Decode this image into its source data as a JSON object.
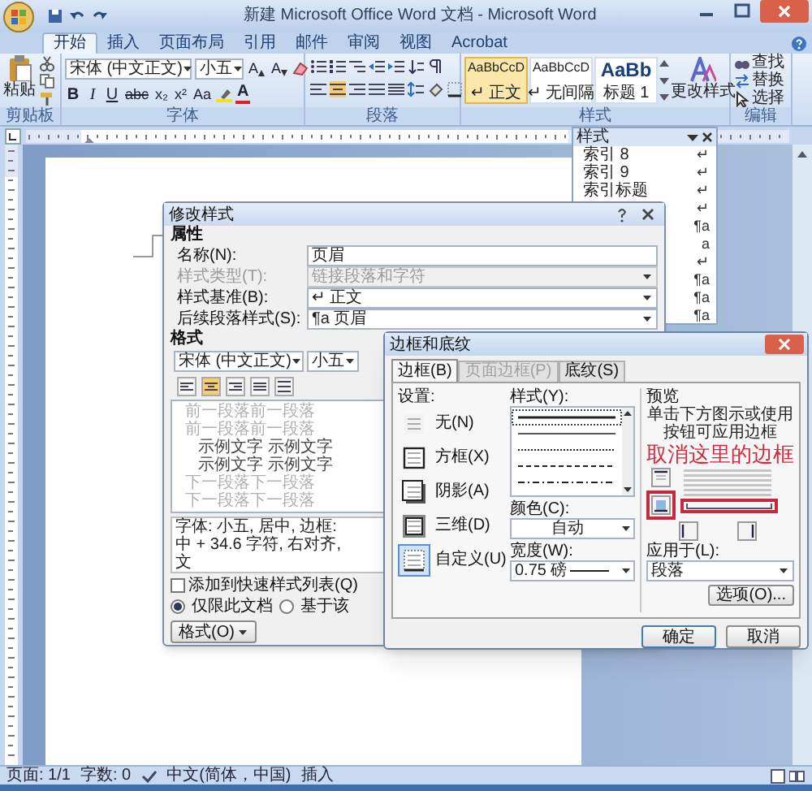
{
  "window": {
    "title": "新建 Microsoft Office Word 文档 - Microsoft Word"
  },
  "tabs": [
    {
      "label": "开始",
      "selected": true
    },
    {
      "label": "插入",
      "selected": false
    },
    {
      "label": "页面布局",
      "selected": false
    },
    {
      "label": "引用",
      "selected": false
    },
    {
      "label": "邮件",
      "selected": false
    },
    {
      "label": "审阅",
      "selected": false
    },
    {
      "label": "视图",
      "selected": false
    },
    {
      "label": "Acrobat",
      "selected": false
    }
  ],
  "ribbon": {
    "clipboard": {
      "paste": "粘贴",
      "label": "剪贴板"
    },
    "font": {
      "label": "字体",
      "font_name": "宋体 (中文正文)",
      "font_size": "小五",
      "size_buttons": [
        "A",
        "A"
      ],
      "format_buttons": [
        "B",
        "I",
        "U"
      ],
      "script_buttons": [
        "abc",
        "x₂",
        "x²",
        "Aa"
      ],
      "color_button": "A"
    },
    "paragraph": {
      "label": "段落"
    },
    "styles": {
      "label": "样式",
      "change": "更改样式",
      "gallery": [
        {
          "sample": "AaBbCcD",
          "name": "↵ 正文",
          "kind": "body",
          "selected": true
        },
        {
          "sample": "AaBbCcD",
          "name": "↵ 无间隔",
          "kind": "body",
          "selected": false
        },
        {
          "sample": "AaBb",
          "name": "标题 1",
          "kind": "heading",
          "selected": false
        }
      ]
    },
    "editing": {
      "label": "编辑",
      "commands": [
        {
          "label": "查找",
          "kind": "find"
        },
        {
          "label": "替换",
          "kind": "replace"
        },
        {
          "label": "选择",
          "kind": "select"
        }
      ]
    }
  },
  "styles_pane": {
    "title": "样式",
    "items": [
      {
        "name": "索引 8",
        "mark": "↵"
      },
      {
        "name": "索引 9",
        "mark": "↵"
      },
      {
        "name": "索引标题",
        "mark": "↵"
      },
      {
        "mark": "↵"
      },
      {
        "mark": "¶a"
      },
      {
        "mark": "a"
      },
      {
        "mark": "↵"
      },
      {
        "mark": "¶a"
      },
      {
        "mark": "¶a"
      },
      {
        "mark": "¶a"
      }
    ]
  },
  "modify_style_dialog": {
    "title": "修改样式",
    "properties_label": "属性",
    "fields": [
      {
        "label": "名称(N):",
        "value": "页眉",
        "kind": "text",
        "disabled": false
      },
      {
        "label": "样式类型(T):",
        "value": "链接段落和字符",
        "kind": "select",
        "disabled": true
      },
      {
        "label": "样式基准(B):",
        "value": "↵ 正文",
        "kind": "select",
        "disabled": false
      },
      {
        "label": "后续段落样式(S):",
        "value": "¶a 页眉",
        "kind": "select",
        "disabled": false
      }
    ],
    "format_label": "格式",
    "font_name": "宋体 (中文正文)",
    "font_size": "小五",
    "preview_lines": [
      {
        "text": "前一段落前一段落",
        "kind": "context"
      },
      {
        "text": "前一段落前一段落",
        "kind": "context"
      },
      {
        "text": "示例文字 示例文字",
        "kind": "sample"
      },
      {
        "text": "示例文字 示例文字",
        "kind": "sample"
      },
      {
        "text": "下一段落下一段落",
        "kind": "context"
      },
      {
        "text": "下一段落下一段落",
        "kind": "context"
      }
    ],
    "description_lines": [
      "字体: 小五, 居中, 边框:",
      "中 + 34.6 字符, 右对齐,",
      "文"
    ],
    "add_to_quick": {
      "label": "添加到快速样式列表(Q)",
      "checked": false
    },
    "scope": [
      {
        "label": "仅限此文档",
        "selected": true
      },
      {
        "label": "基于该",
        "selected": false
      }
    ],
    "format_button": "格式(O)"
  },
  "borders_dialog": {
    "title": "边框和底纹",
    "tabs": [
      {
        "label": "边框(B)",
        "selected": true,
        "disabled": false
      },
      {
        "label": "页面边框(P)",
        "selected": false,
        "disabled": true
      },
      {
        "label": "底纹(S)",
        "selected": false,
        "disabled": false
      }
    ],
    "setting_label": "设置:",
    "settings": [
      {
        "label": "无(N)",
        "kind": "none",
        "selected": false
      },
      {
        "label": "方框(X)",
        "kind": "box",
        "selected": false
      },
      {
        "label": "阴影(A)",
        "kind": "shadow",
        "selected": false
      },
      {
        "label": "三维(D)",
        "kind": "three_d",
        "selected": false
      },
      {
        "label": "自定义(U)",
        "kind": "custom",
        "selected": true
      }
    ],
    "style_label": "样式(Y):",
    "line_styles": [
      {
        "kind": "solid",
        "selected": true
      },
      {
        "kind": "thin",
        "selected": false
      },
      {
        "kind": "dotted",
        "selected": false
      },
      {
        "kind": "dashed",
        "selected": false
      },
      {
        "kind": "dash_dot",
        "selected": false
      }
    ],
    "color_label": "颜色(C):",
    "color_value": "自动",
    "width_label": "宽度(W):",
    "width_value": "0.75 磅",
    "preview_label": "预览",
    "preview_hint": "单击下方图示或使用按钮可应用边框",
    "annotation": "取消这里的边框",
    "apply_label": "应用于(L):",
    "apply_value": "段落",
    "options_button": "选项(O)...",
    "ok_button": "确定",
    "cancel_button": "取消"
  },
  "status_bar": {
    "page": "页面: 1/1",
    "words": "字数: 0",
    "language": "中文(简体，中国)",
    "mode": "插入"
  }
}
